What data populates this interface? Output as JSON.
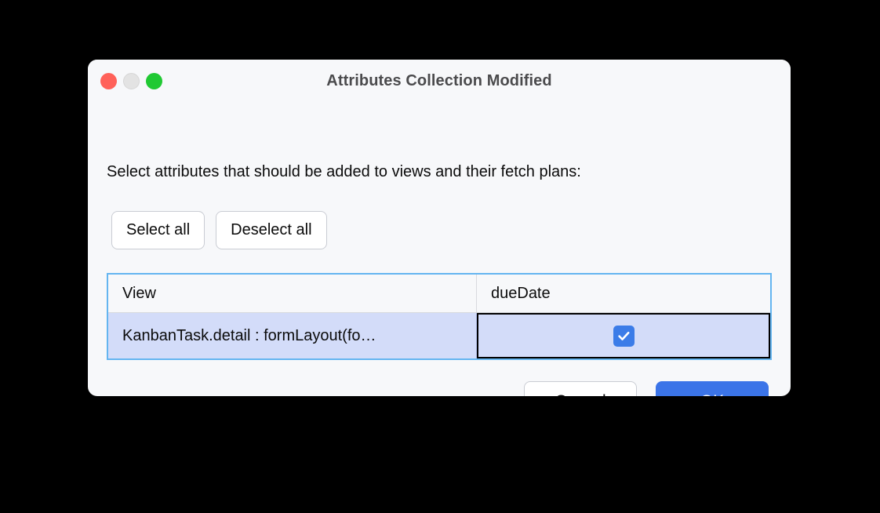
{
  "window": {
    "title": "Attributes Collection Modified",
    "traffic_lights": [
      {
        "name": "close-button",
        "color": "#ff6159"
      },
      {
        "name": "minimize-button",
        "color": "#e3e3e3"
      },
      {
        "name": "maximize-button",
        "color": "#20c933"
      }
    ]
  },
  "dialog": {
    "instruction": "Select attributes that should be added to views and their fetch plans:",
    "select_all_label": "Select all",
    "deselect_all_label": "Deselect all"
  },
  "table": {
    "columns": [
      "View",
      "dueDate"
    ],
    "rows": [
      {
        "view": "KanbanTask.detail : formLayout(fo…",
        "dueDate_checked": true,
        "selected": true,
        "focused_cell": "dueDate"
      }
    ]
  },
  "footer": {
    "cancel_label": "Cancel",
    "ok_label": "OK"
  },
  "colors": {
    "accent": "#3b74e8",
    "checkbox": "#3b7ce8",
    "table_border": "#64b5f0",
    "selected_row": "#d3dcf9",
    "window_bg": "#f7f8fa",
    "desktop_bg": "#000000"
  }
}
